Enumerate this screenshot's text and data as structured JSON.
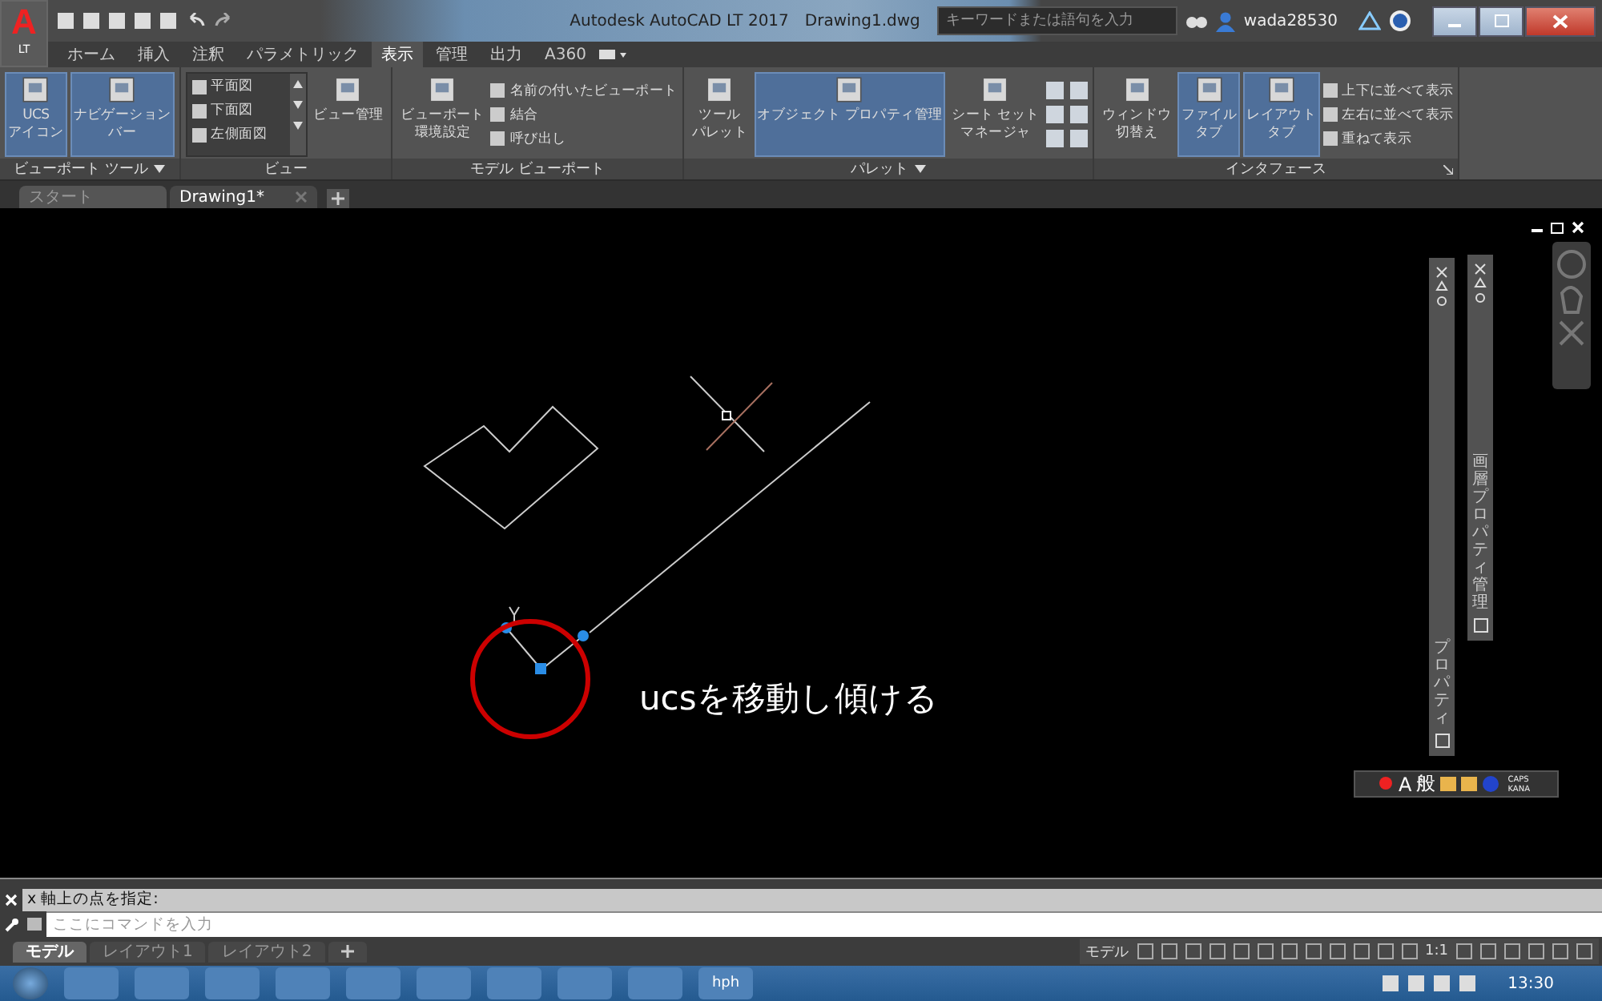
{
  "app_button": {
    "logo": "A",
    "label": "LT"
  },
  "window": {
    "title": "Autodesk AutoCAD LT 2017",
    "file": "Drawing1.dwg"
  },
  "search": {
    "placeholder": "キーワードまたは語句を入力"
  },
  "user": {
    "name": "wada28530"
  },
  "ribbon_tabs": [
    {
      "label": "ホーム",
      "selected": false
    },
    {
      "label": "挿入",
      "selected": false
    },
    {
      "label": "注釈",
      "selected": false
    },
    {
      "label": "パラメトリック",
      "selected": false
    },
    {
      "label": "表示",
      "selected": true
    },
    {
      "label": "管理",
      "selected": false
    },
    {
      "label": "出力",
      "selected": false
    },
    {
      "label": "A360",
      "selected": false
    }
  ],
  "panels": [
    {
      "title": "ビューポート ツール",
      "menu": true,
      "launcher": false,
      "items": [
        {
          "kind": "large",
          "lines": [
            "UCS",
            "アイコン"
          ],
          "selected": true
        },
        {
          "kind": "large",
          "lines": [
            "ナビゲーション",
            "バー"
          ],
          "selected": true
        }
      ]
    },
    {
      "title": "ビュー",
      "menu": false,
      "launcher": false,
      "items": [
        {
          "kind": "list",
          "entries": [
            "平面図",
            "下面図",
            "左側面図"
          ]
        },
        {
          "kind": "large",
          "lines": [
            "ビュー管理"
          ],
          "selected": false
        }
      ]
    },
    {
      "title": "モデル ビューポート",
      "menu": false,
      "launcher": false,
      "items": [
        {
          "kind": "large",
          "lines": [
            "ビューポート",
            "環境設定"
          ],
          "selected": false
        },
        {
          "kind": "small",
          "entries": [
            "名前の付いたビューポート",
            "結合",
            "呼び出し"
          ]
        }
      ]
    },
    {
      "title": "パレット",
      "menu": true,
      "launcher": false,
      "items": [
        {
          "kind": "large",
          "lines": [
            "ツール",
            "パレット"
          ],
          "selected": false
        },
        {
          "kind": "large",
          "lines": [
            "オブジェクト プロパティ管理"
          ],
          "selected": true
        },
        {
          "kind": "large",
          "lines": [
            "シート セット",
            "マネージャ"
          ],
          "selected": false
        },
        {
          "kind": "grid"
        }
      ]
    },
    {
      "title": "インタフェース",
      "menu": false,
      "launcher": true,
      "items": [
        {
          "kind": "large",
          "lines": [
            "ウィンドウ",
            "切替え"
          ],
          "selected": false
        },
        {
          "kind": "large",
          "lines": [
            "ファイル",
            "タブ"
          ],
          "selected": true
        },
        {
          "kind": "large",
          "lines": [
            "レイアウト",
            "タブ"
          ],
          "selected": true
        },
        {
          "kind": "small",
          "entries": [
            "上下に並べて表示",
            "左右に並べて表示",
            "重ねて表示"
          ]
        }
      ]
    }
  ],
  "doc_tabs": [
    {
      "label": "スタート",
      "selected": false
    },
    {
      "label": "Drawing1*",
      "selected": true
    }
  ],
  "palettes": [
    {
      "title": "プロパティ"
    },
    {
      "title": "画層プロパティ管理"
    }
  ],
  "annotation": "ucsを移動し傾ける",
  "ime": {
    "mode": "A",
    "kanji": "般",
    "caps": "CAPS",
    "kana": "KANA"
  },
  "command": {
    "history": "x 軸上の点を指定:",
    "placeholder": "ここにコマンドを入力"
  },
  "layout_tabs": [
    {
      "label": "モデル",
      "selected": true
    },
    {
      "label": "レイアウト1",
      "selected": false
    },
    {
      "label": "レイアウト2",
      "selected": false
    }
  ],
  "status_bar": {
    "space": "モデル",
    "scale": "1:1"
  },
  "taskbar": {
    "app_label": "hph",
    "clock": "13:30"
  }
}
